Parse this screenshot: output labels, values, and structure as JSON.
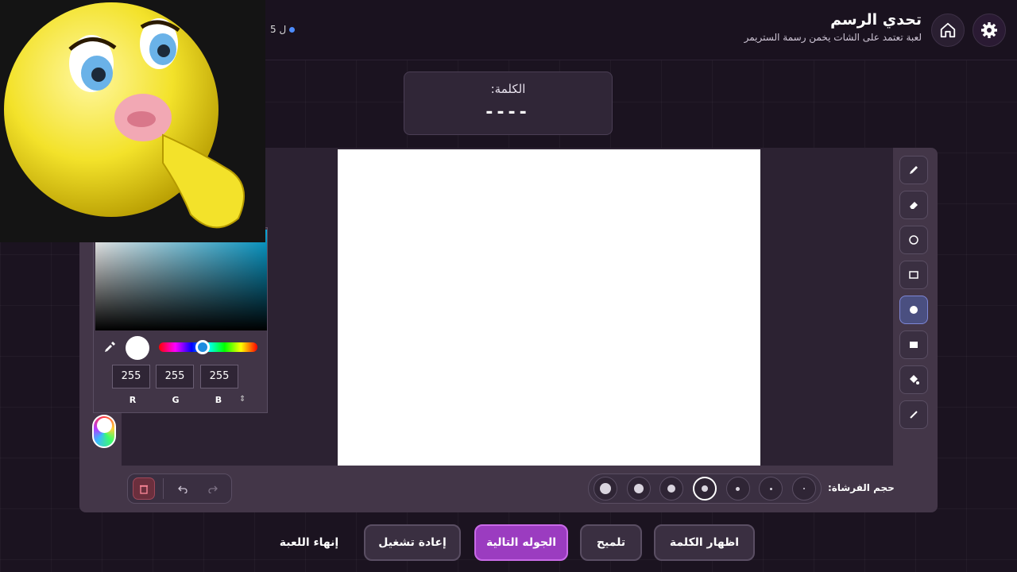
{
  "header": {
    "title": "تحدي الرسم",
    "subtitle": "لعبة تعتمد على الشات يخمن رسمة الستريمر",
    "counter": "5 ل"
  },
  "word_card": {
    "label": "الكلمة:",
    "blanks": "----"
  },
  "tools": [
    {
      "icon": "pencil-icon"
    },
    {
      "icon": "eraser-icon"
    },
    {
      "icon": "circle-outline-icon"
    },
    {
      "icon": "rectangle-outline-icon"
    },
    {
      "icon": "filled-circle-icon",
      "active": true
    },
    {
      "icon": "filled-rectangle-icon"
    },
    {
      "icon": "fill-bucket-icon"
    },
    {
      "icon": "line-icon"
    }
  ],
  "brush": {
    "label": "حجم الفرشاة:",
    "selected_index": 3
  },
  "color_picker": {
    "r": "255",
    "g": "255",
    "b": "255",
    "r_label": "R",
    "g_label": "G",
    "b_label": "B",
    "swap": "⇕",
    "current_color": "#ffffff",
    "gradient_hue": "#0aa6d8"
  },
  "bottom_buttons": {
    "show_word": "اظهار الكلمة",
    "hint": "تلميح",
    "next_round": "الجوله التالية",
    "restart": "إعادة تشغيل",
    "end_game": "إنهاء اللعبة"
  },
  "colors": {
    "accent": "#9b3cc0",
    "background": "#1b1320",
    "panel": "#433648"
  }
}
